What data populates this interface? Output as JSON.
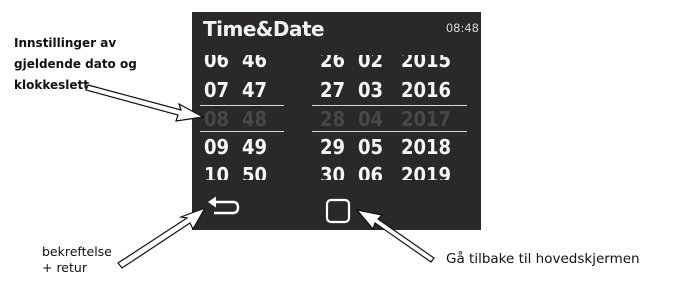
{
  "annotations": {
    "settings_lines": [
      "Innstillinger av",
      "gjeldende dato og",
      "klokkeslett"
    ],
    "confirm_lines": [
      "bekreftelse",
      "+ retur"
    ],
    "home": "Gå tilbake til hovedskjermen"
  },
  "screen": {
    "title": "Time&Date",
    "clock": "08:48",
    "selected_index": 2,
    "rows": [
      {
        "hour": "06",
        "minute": "46",
        "day": "26",
        "month": "02",
        "year": "2015"
      },
      {
        "hour": "07",
        "minute": "47",
        "day": "27",
        "month": "03",
        "year": "2016"
      },
      {
        "hour": "08",
        "minute": "48",
        "day": "28",
        "month": "04",
        "year": "2017"
      },
      {
        "hour": "09",
        "minute": "49",
        "day": "29",
        "month": "05",
        "year": "2018"
      },
      {
        "hour": "10",
        "minute": "50",
        "day": "30",
        "month": "06",
        "year": "2019"
      }
    ],
    "icons": {
      "back": "return-arrow-icon",
      "home": "square-home-icon"
    },
    "colors": {
      "background": "#2a2927",
      "text": "#f5f5f5",
      "selected_text": "#4a4845"
    }
  }
}
